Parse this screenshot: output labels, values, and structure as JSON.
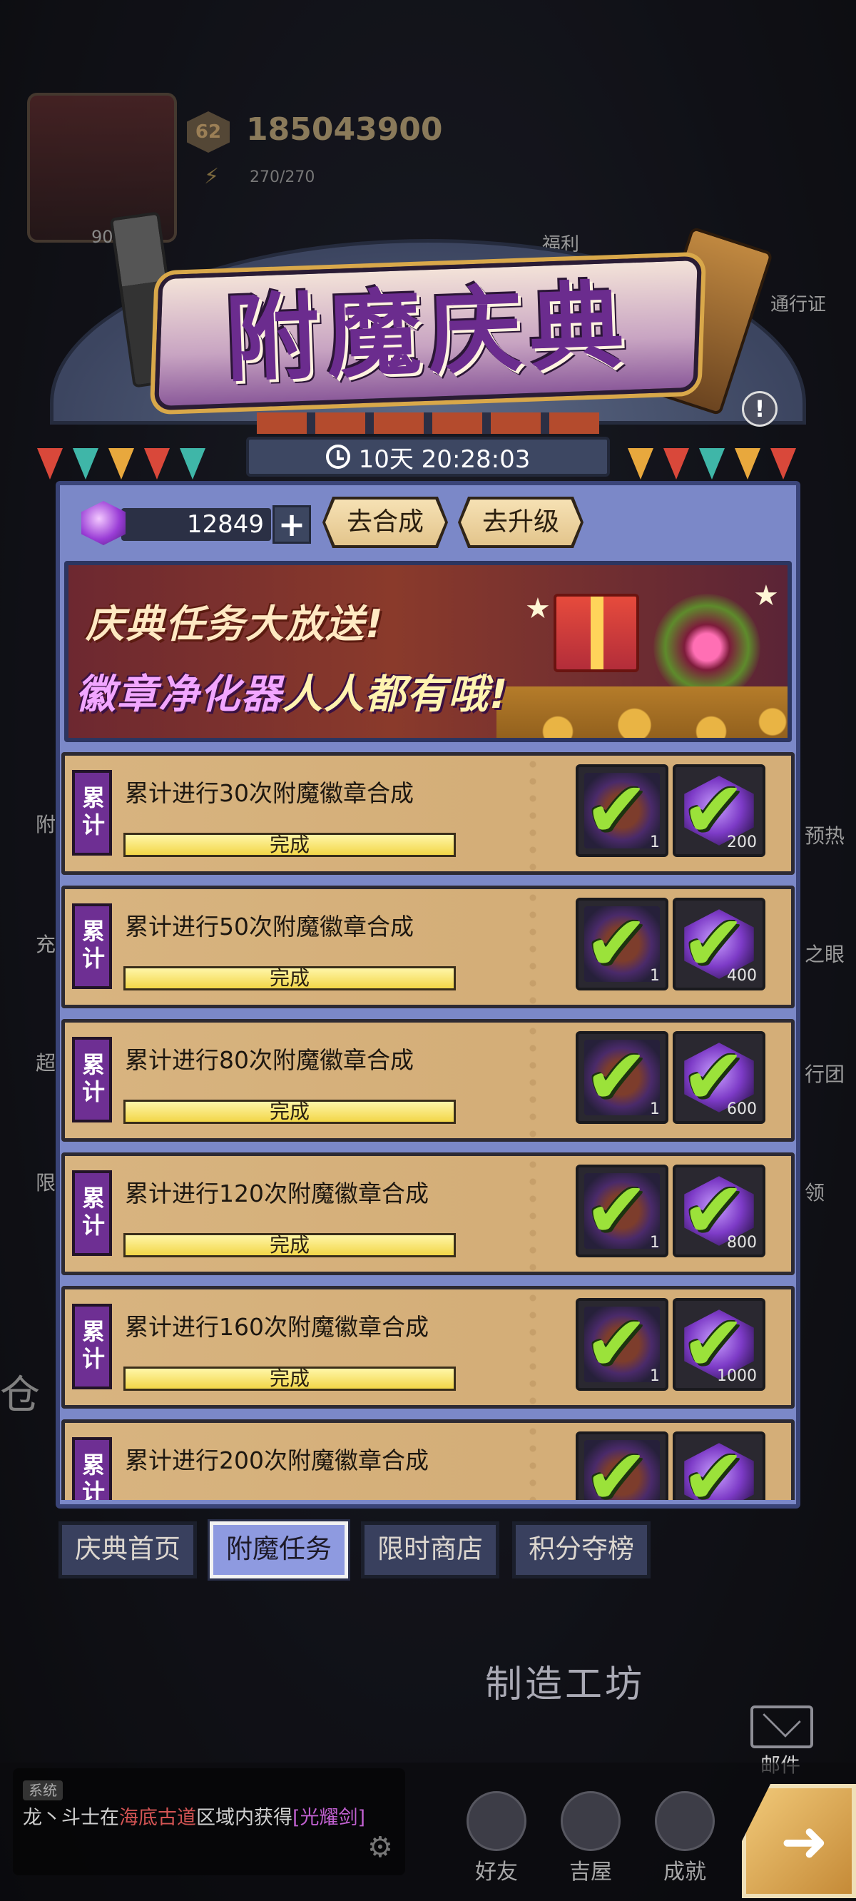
{
  "background": {
    "gold_amount": "185043900",
    "level": "62",
    "energy": "270/270",
    "avatar_level": "90",
    "welfare_label": "福利",
    "pass_label": "通行证",
    "side_labels_right": [
      "预热",
      "之眼",
      "行团",
      "领"
    ],
    "side_labels_left": [
      "附",
      "充",
      "超",
      "限"
    ],
    "workshop_label": "制造工坊",
    "warehouse_label": "仓",
    "mail_label": "邮件",
    "chat": {
      "tag": "系统",
      "player": "龙丶斗士",
      "text_1": "在",
      "location": "海底古道",
      "text_2": "区域内获得",
      "item": "[光耀剑]"
    },
    "bottom_nav": [
      {
        "label": "好友"
      },
      {
        "label": "吉屋"
      },
      {
        "label": "成就"
      }
    ]
  },
  "event": {
    "title": "附魔庆典",
    "timer": "10天 20:28:03",
    "info_symbol": "!"
  },
  "currency": {
    "amount": "12849",
    "plus_symbol": "+"
  },
  "actions": {
    "synthesize_label": "去合成",
    "upgrade_label": "去升级"
  },
  "promo": {
    "line1": "庆典任务大放送!",
    "line2_highlight": "徽章净化器",
    "line2_rest": "人人都有哦!"
  },
  "tasks": [
    {
      "tag": "累计",
      "title": "累计进行30次附魔徽章合成",
      "status": "完成",
      "reward1_count": "1",
      "reward2_count": "200"
    },
    {
      "tag": "累计",
      "title": "累计进行50次附魔徽章合成",
      "status": "完成",
      "reward1_count": "1",
      "reward2_count": "400"
    },
    {
      "tag": "累计",
      "title": "累计进行80次附魔徽章合成",
      "status": "完成",
      "reward1_count": "1",
      "reward2_count": "600"
    },
    {
      "tag": "累计",
      "title": "累计进行120次附魔徽章合成",
      "status": "完成",
      "reward1_count": "1",
      "reward2_count": "800"
    },
    {
      "tag": "累计",
      "title": "累计进行160次附魔徽章合成",
      "status": "完成",
      "reward1_count": "1",
      "reward2_count": "1000"
    },
    {
      "tag": "累计",
      "title": "累计进行200次附魔徽章合成",
      "status": "",
      "reward1_count": "",
      "reward2_count": ""
    }
  ],
  "tabs": [
    {
      "label": "庆典首页",
      "active": false
    },
    {
      "label": "附魔任务",
      "active": true
    },
    {
      "label": "限时商店",
      "active": false
    },
    {
      "label": "积分夺榜",
      "active": false
    }
  ],
  "colors": {
    "panel": "#7b88c8",
    "task_bg": "#d8b480",
    "tag_purple": "#6e2f93",
    "check_green": "#9be23a",
    "progress_yellow": "#f2d648"
  }
}
